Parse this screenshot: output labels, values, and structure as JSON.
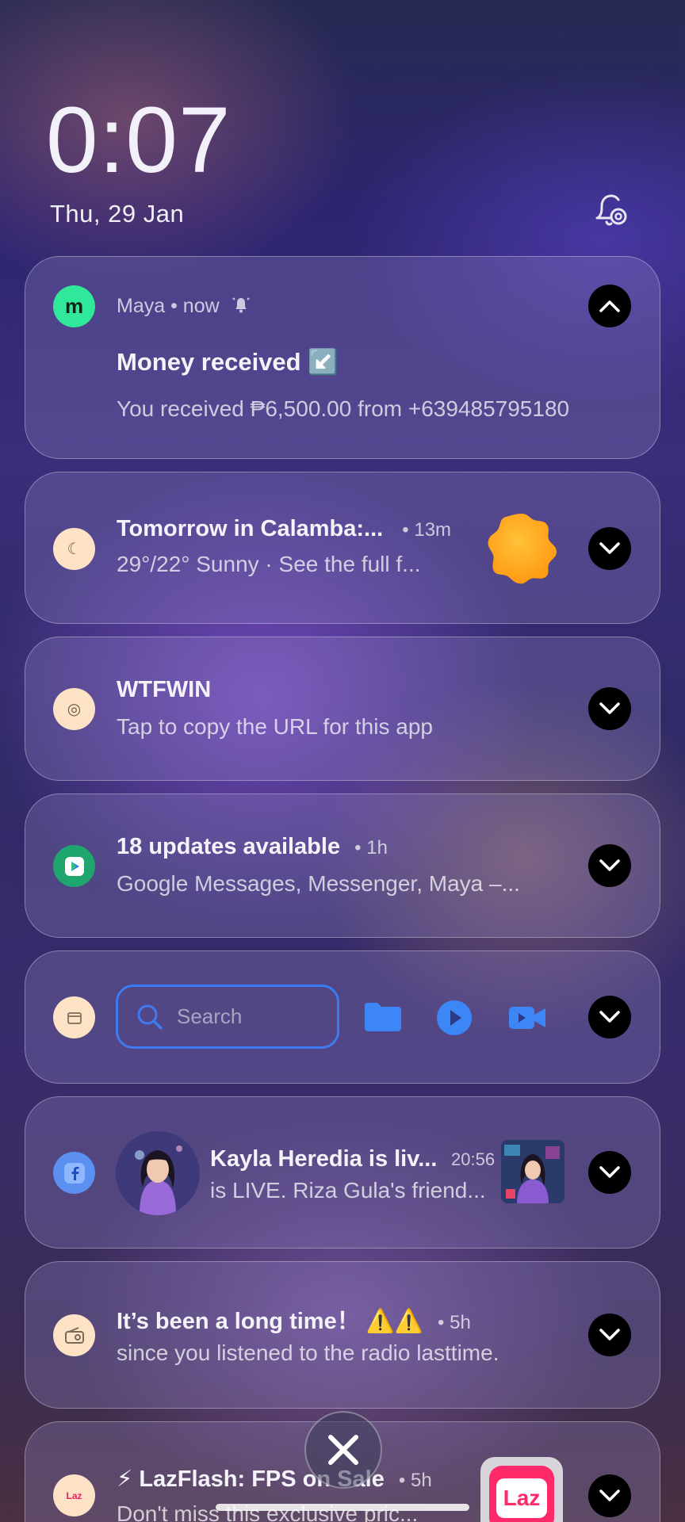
{
  "lockscreen": {
    "time": "0:07",
    "date": "Thu, 29 Jan"
  },
  "notifications": [
    {
      "app_name": "Maya",
      "time": "now",
      "title": "Money received ↙️",
      "body": "You received ₱6,500.00 from +639485795180",
      "expanded": true
    },
    {
      "title": "Tomorrow in Calamba:...",
      "time": "13m",
      "body": "29°/22° Sunny · See the full f..."
    },
    {
      "title": "WTFWIN",
      "body": "Tap to copy the URL for this app"
    },
    {
      "title": "18 updates available",
      "time": "1h",
      "body": "Google Messages, Messenger, Maya –..."
    },
    {
      "search_placeholder": "Search"
    },
    {
      "title": "Kayla Heredia is liv...",
      "time": "20:56",
      "body": "is LIVE. Riza Gula's friend..."
    },
    {
      "title": " It’s been a long time！ ⚠️⚠️",
      "time": "5h",
      "body": "since you listened to the radio lasttime."
    },
    {
      "title": "⚡ LazFlash: FPS on Sale",
      "time": "5h",
      "body": "Don't miss this exclusive pric...",
      "thumb_text": "Laz",
      "icon_text": "Laz"
    }
  ],
  "colors": {
    "maya_green": "#2fe89a",
    "accent_blue": "#3d7cf0",
    "sun_orange": "#ffa21a"
  }
}
